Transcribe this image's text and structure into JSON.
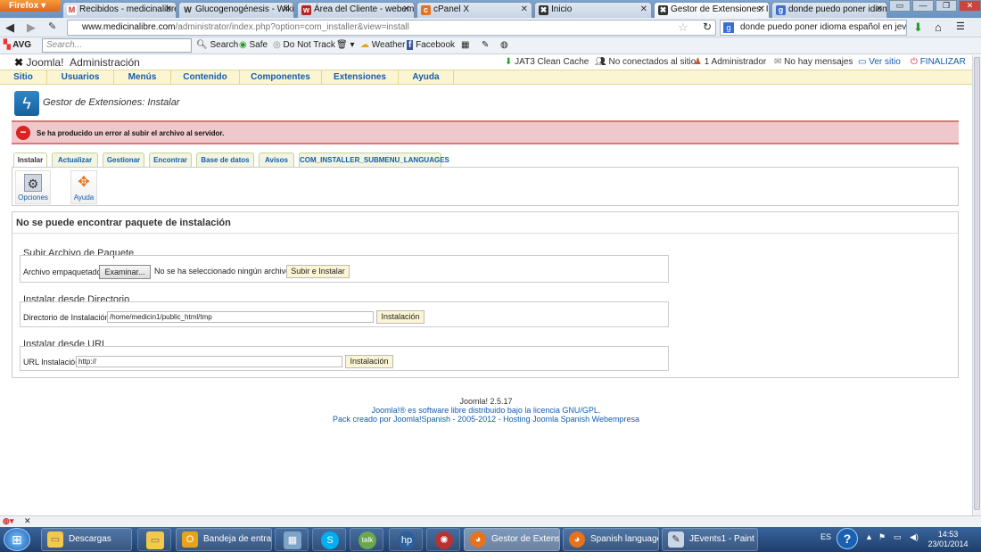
{
  "browser": {
    "app_button": "Firefox",
    "tabs": [
      {
        "label": "Recibidos - medicinalibre....",
        "icon": "gmail-icon"
      },
      {
        "label": "Glucogenogénesis - Wikip...",
        "icon": "wikipedia-icon"
      },
      {
        "label": "Área del Cliente - webemp...",
        "icon": "webempresa-icon"
      },
      {
        "label": "cPanel X",
        "icon": "cpanel-icon"
      },
      {
        "label": "Inicio",
        "icon": "joomla-icon"
      },
      {
        "label": "Gestor de Extensiones: Inst...",
        "icon": "joomla-icon"
      },
      {
        "label": "donde puedo poner idiom...",
        "icon": "google-icon"
      }
    ],
    "active_tab": 5,
    "url_host": "www.medicinalibre.com",
    "url_path": "/administrator/index.php?option=com_installer&view=install",
    "search_value": "donde puedo poner idioma español en jevents"
  },
  "avg": {
    "logo": "AVG",
    "search_placeholder": "Search...",
    "search_button": "Search",
    "safe": "Safe",
    "dnt": "Do Not Track",
    "weather": "Weather",
    "facebook": "Facebook"
  },
  "joomla": {
    "brand": "Joomla!",
    "admin_label": "Administración",
    "status": {
      "cache": "JAT3 Clean Cache",
      "not_connected": "No conectados al sitio",
      "admins": "1 Administrador",
      "messages": "No hay mensajes",
      "view_site": "Ver sitio",
      "logout": "FINALIZAR"
    },
    "menu": [
      "Sitio",
      "Usuarios",
      "Menús",
      "Contenido",
      "Componentes",
      "Extensiones",
      "Ayuda"
    ],
    "page_title": "Gestor de Extensiones: Instalar",
    "error_message": "Se ha producido un error al subir el archivo al servidor.",
    "subtabs": [
      "Instalar",
      "Actualizar",
      "Gestionar",
      "Encontrar",
      "Base de datos",
      "Avisos",
      "COM_INSTALLER_SUBMENU_LANGUAGES"
    ],
    "active_subtab": 0,
    "toolbar": {
      "options": "Opciones",
      "help": "Ayuda"
    },
    "main_title": "No se puede encontrar paquete de instalación",
    "upload": {
      "legend": "Subir Archivo de Paquete",
      "label": "Archivo empaquetado",
      "browse": "Examinar...",
      "no_file": "No se ha seleccionado ningún archivo.",
      "submit": "Subir e Instalar"
    },
    "directory": {
      "legend": "Instalar desde Directorio",
      "label": "Directorio de Instalación",
      "value": "/home/medicin1/public_html/tmp",
      "submit": "Instalación"
    },
    "url": {
      "legend": "Instalar desde URL",
      "label": "URL Instalación",
      "value": "http://",
      "submit": "Instalación"
    },
    "footer": {
      "version": "Joomla! 2.5.17",
      "license": "Joomla!® es software libre distribuido bajo la licencia GNU/GPL.",
      "credits": "Pack creado por Joomla!Spanish - 2005-2012 - Hosting Joomla Spanish Webempresa"
    }
  },
  "taskbar": {
    "items": [
      {
        "label": "Descargas",
        "icon": "folder-icon"
      },
      {
        "label": "Bandeja de entrad...",
        "icon": "outlook-icon"
      },
      {
        "label": "Gestor de Extensi...",
        "icon": "firefox-icon"
      },
      {
        "label": "Spanish language...",
        "icon": "firefox-icon"
      },
      {
        "label": "JEvents1 - Paint",
        "icon": "paint-icon"
      }
    ],
    "language": "ES",
    "time": "14:53",
    "date": "23/01/2014"
  },
  "colors": {
    "link": "#135cae",
    "menu_bg": "#fbf5d3",
    "error_bg": "#efc8cb",
    "taskbar": "#1e3e6c"
  }
}
